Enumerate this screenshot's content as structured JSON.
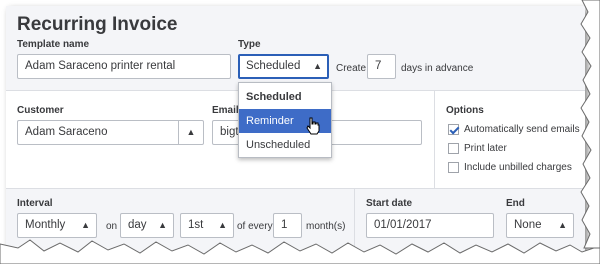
{
  "title": "Recurring Invoice",
  "template": {
    "label": "Template name",
    "value": "Adam Saraceno printer rental"
  },
  "type": {
    "label": "Type",
    "selected": "Scheduled",
    "options": [
      "Scheduled",
      "Reminder",
      "Unscheduled"
    ],
    "highlighted": "Reminder"
  },
  "create": {
    "prefix": "Create",
    "days": "7",
    "suffix": "days in advance"
  },
  "customer": {
    "label": "Customer",
    "value": "Adam Saraceno"
  },
  "email": {
    "label": "Email",
    "value": "bigti"
  },
  "options": {
    "label": "Options",
    "items": [
      {
        "label": "Automatically send emails",
        "checked": true
      },
      {
        "label": "Print later",
        "checked": false
      },
      {
        "label": "Include unbilled charges",
        "checked": false
      }
    ]
  },
  "interval": {
    "label": "Interval",
    "frequency": "Monthly",
    "on_label": "on",
    "unit": "day",
    "day": "1st",
    "every_label": "of every",
    "count": "1",
    "suffix": "month(s)"
  },
  "start_date": {
    "label": "Start date",
    "value": "01/01/2017"
  },
  "end": {
    "label": "End",
    "value": "None"
  },
  "icons": {
    "select": "updown-arrows-icon",
    "checkbox": "checkmark-icon",
    "cursor": "hand-pointer-icon"
  },
  "colors": {
    "accent": "#2b5fb7",
    "highlight": "#3e6cc7",
    "band": "#f4f5f8"
  }
}
